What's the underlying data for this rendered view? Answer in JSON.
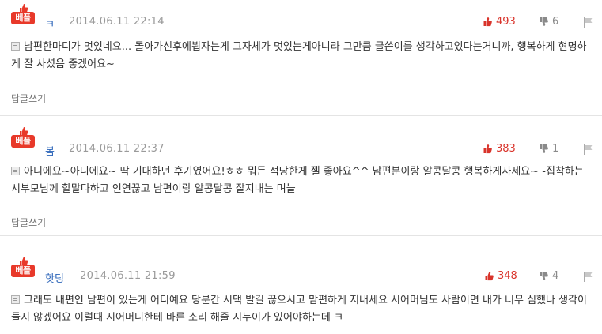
{
  "comments": [
    {
      "badge": "베플",
      "author": "ㅋ",
      "date": "2014.06.11 22:14",
      "likes": "493",
      "dislikes": "6",
      "text": "남편한마디가 멋있네요... 돌아가신후에뵙자는게 그자체가 멋있는게아니라 그만큼 글쓴이를 생각하고있다는거니까, 행복하게 현명하게 잘 사셨음 좋겠어요~",
      "reply_label": "답글쓰기"
    },
    {
      "badge": "베플",
      "author": "봄",
      "date": "2014.06.11 22:37",
      "likes": "383",
      "dislikes": "1",
      "text": "아니에요~아니에요~ 딱 기대하던 후기였어요!ㅎㅎ 뭐든 적당한게 젤 좋아요^^ 남편분이랑 알콩달콩 행복하게사세요~ -집착하는 시부모님께 할말다하고 인연끊고 남편이랑 알콩달콩 잘지내는 며늘",
      "reply_label": "답글쓰기"
    },
    {
      "badge": "베플",
      "author": "핫팅",
      "date": "2014.06.11 21:59",
      "likes": "348",
      "dislikes": "4",
      "text": "그래도 내편인 남편이 있는게 어디예요 당분간 시댁 발길 끊으시고 맘편하게 지내세요 시어머님도 사람이면 내가 너무 심했나 생각이 들지 않겠어요 이럴때 시어머니한테 바른 소리 해줄 시누이가 있어야하는데 ㅋ"
    }
  ],
  "colors": {
    "badge": "#e8392a",
    "author": "#2a63b8",
    "likes": "#d9342b",
    "date": "#9a9a9a"
  },
  "icons": {
    "badge": "thumbs-up-icon",
    "like": "thumbs-up-icon",
    "dislike": "thumbs-down-icon",
    "report": "report-flag-icon",
    "body": "document-icon"
  }
}
